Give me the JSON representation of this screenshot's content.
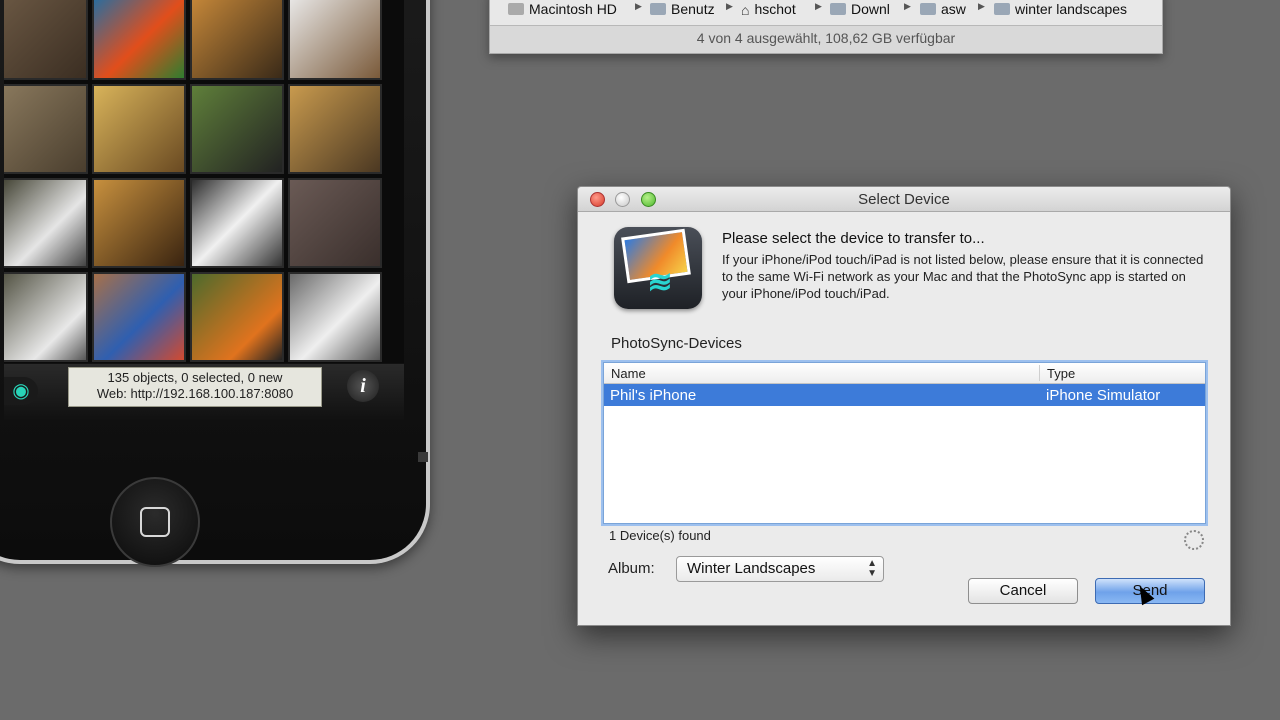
{
  "finder": {
    "path": [
      "Macintosh HD",
      "Benutz",
      "hschot",
      "Downl",
      "asw",
      "winter landscapes"
    ],
    "status": "4 von 4 ausgewählt, 108,62 GB verfügbar"
  },
  "simulator": {
    "status_line1": "135 objects, 0 selected, 0 new",
    "status_line2": "Web: http://192.168.100.187:8080",
    "info_glyph": "i",
    "eye_glyph": "◉"
  },
  "dialog": {
    "title": "Select Device",
    "heading": "Please select the device to transfer to...",
    "description": "If your iPhone/iPod touch/iPad is not listed below, please ensure that it is connected to the same Wi-Fi network as your Mac and that the PhotoSync app is started on your iPhone/iPod touch/iPad.",
    "section_label": "PhotoSync-Devices",
    "columns": {
      "name": "Name",
      "type": "Type"
    },
    "rows": [
      {
        "name": "Phil's iPhone",
        "type": "iPhone Simulator"
      }
    ],
    "found_text": "1 Device(s) found",
    "album_label": "Album:",
    "album_value": "Winter Landscapes",
    "cancel_label": "Cancel",
    "send_label": "Send"
  }
}
